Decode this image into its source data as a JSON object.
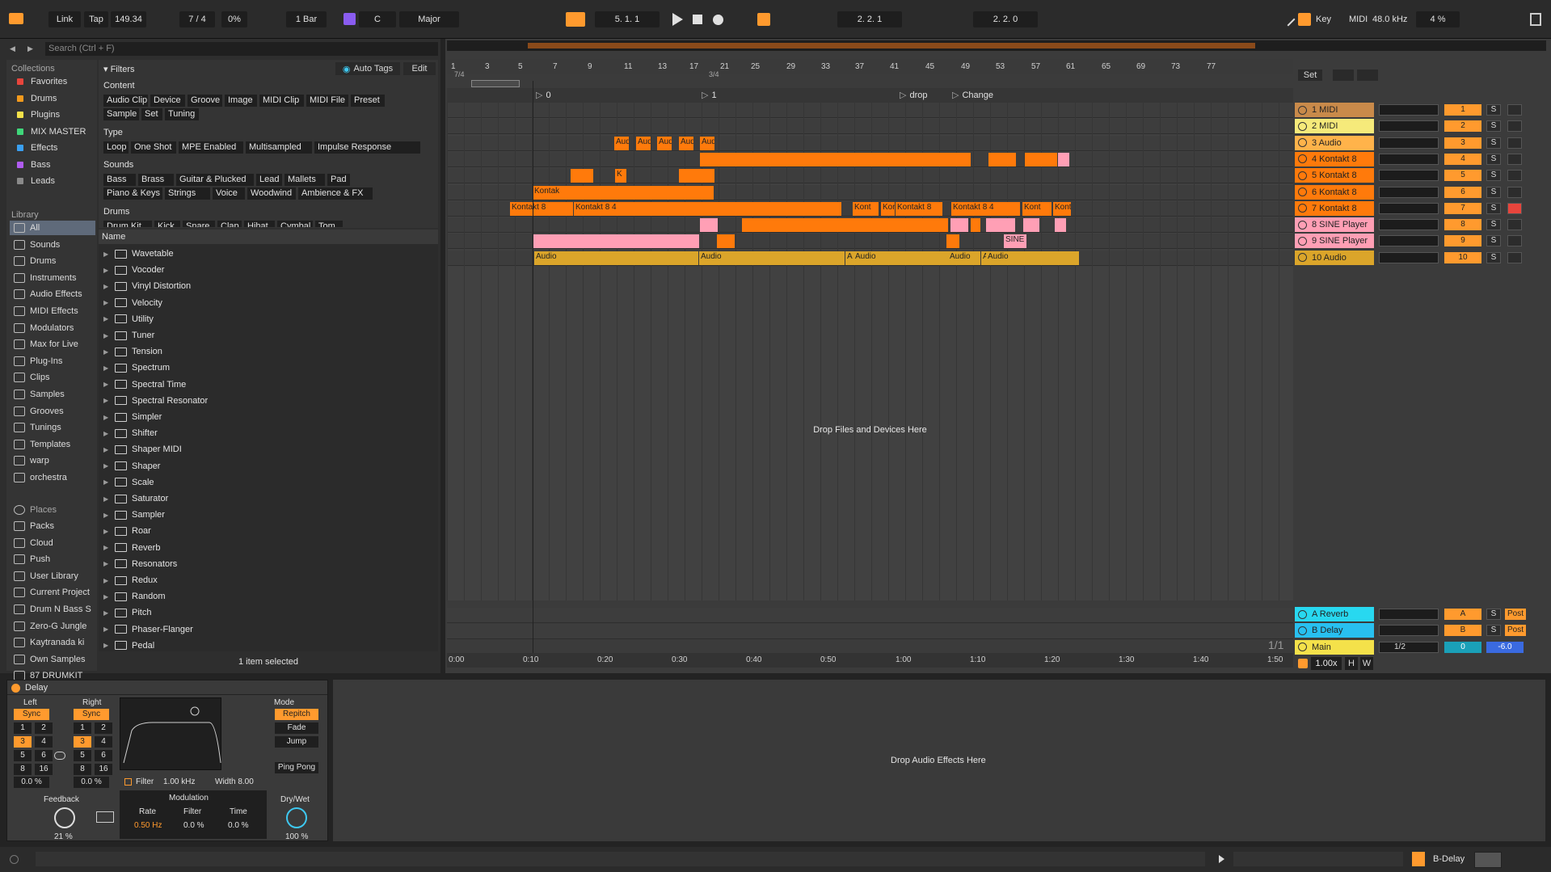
{
  "topbar": {
    "link": "Link",
    "tap": "Tap",
    "tempo": "149.34",
    "signature": "7 / 4",
    "swing": "0%",
    "quantize": "1 Bar",
    "key_root": "C",
    "scale": "Major",
    "position": "5.  1.  1",
    "loop_start": "2.  2.  1",
    "loop_length": "2.  2.  0",
    "key_btn": "Key",
    "midi_btn": "MIDI",
    "sample_rate": "48.0 kHz",
    "cpu": "4 %"
  },
  "browser": {
    "search_placeholder": "Search (Ctrl + F)",
    "collections_title": "Collections",
    "collections": [
      {
        "label": "Favorites",
        "color": "#e8453c"
      },
      {
        "label": "Drums",
        "color": "#f39a1d"
      },
      {
        "label": "Plugins",
        "color": "#f4e14a"
      },
      {
        "label": "MIX MASTER",
        "color": "#3fd67a"
      },
      {
        "label": "Effects",
        "color": "#3aa0f2"
      },
      {
        "label": "Bass",
        "color": "#b05cf0"
      },
      {
        "label": "Leads",
        "color": "#8a8a8a"
      }
    ],
    "library_title": "Library",
    "library": [
      "All",
      "Sounds",
      "Drums",
      "Instruments",
      "Audio Effects",
      "MIDI Effects",
      "Modulators",
      "Max for Live",
      "Plug-Ins",
      "Clips",
      "Samples",
      "Grooves",
      "Tunings",
      "Templates",
      "warp",
      "orchestra"
    ],
    "places_title": "Places",
    "places": [
      "Packs",
      "Cloud",
      "Push",
      "User Library",
      "Current Project",
      "Drum N Bass S",
      "Zero-G Jungle",
      "Kaytranada ki",
      "Own Samples",
      "87 DRUMKIT"
    ],
    "filters": {
      "title": "Filters",
      "auto_tags": "Auto Tags",
      "edit": "Edit",
      "content_label": "Content",
      "content": [
        "Audio Clip",
        "Device",
        "Groove",
        "Image",
        "MIDI Clip",
        "MIDI File",
        "Preset",
        "Sample",
        "Set",
        "Tuning"
      ],
      "type_label": "Type",
      "type": [
        "Loop",
        "One Shot",
        "MPE Enabled",
        "Multisampled",
        "Impulse Response"
      ],
      "sounds_label": "Sounds",
      "sounds": [
        "Bass",
        "Brass",
        "Guitar & Plucked",
        "Lead",
        "Mallets",
        "Pad",
        "Piano & Keys",
        "Strings",
        "Voice",
        "Woodwind",
        "Ambience & FX"
      ],
      "drums_label": "Drums",
      "drums": [
        "Drum Kit",
        "Kick",
        "Snare",
        "Clap",
        "Hihat",
        "Cymbal",
        "Tom"
      ]
    },
    "list_header": "Name",
    "items": [
      "Wavetable",
      "Vocoder",
      "Vinyl Distortion",
      "Velocity",
      "Utility",
      "Tuner",
      "Tension",
      "Spectrum",
      "Spectral Time",
      "Spectral Resonator",
      "Simpler",
      "Shifter",
      "Shaper MIDI",
      "Shaper",
      "Scale",
      "Saturator",
      "Sampler",
      "Roar",
      "Reverb",
      "Resonators",
      "Redux",
      "Random",
      "Pitch",
      "Phaser-Flanger",
      "Pedal"
    ],
    "status": "1 item selected"
  },
  "arrangement": {
    "bar_labels": [
      "1",
      "3",
      "5",
      "7",
      "9",
      "11",
      "13",
      "17",
      "21",
      "25",
      "29",
      "33",
      "37",
      "41",
      "45",
      "49",
      "53",
      "57",
      "61",
      "65",
      "69",
      "73",
      "77"
    ],
    "signature_markers": [
      "7/4",
      "3/4"
    ],
    "locators": [
      "0",
      "1",
      "drop",
      "Change"
    ],
    "drop_hint": "Drop Files and Devices Here",
    "time_labels": [
      "0:00",
      "0:10",
      "0:20",
      "0:30",
      "0:40",
      "0:50",
      "1:00",
      "1:10",
      "1:20",
      "1:30",
      "1:40",
      "1:50"
    ],
    "page_indicator": "1/1",
    "set_btn": "Set",
    "clip_labels": {
      "aud": "Aud",
      "kontakt": "Kontakt 8",
      "kontakt84": "Kontakt 8 4",
      "kont": "Kont",
      "k": "K",
      "kontak": "Kontak",
      "sine": "SINE",
      "audio": "Audio",
      "a": "A"
    }
  },
  "tracks": [
    {
      "name": "1 MIDI",
      "num": "1",
      "color": "#c98a4a"
    },
    {
      "name": "2 MIDI",
      "num": "2",
      "color": "#f6ea7a"
    },
    {
      "name": "3 Audio",
      "num": "3",
      "color": "#ffb34a"
    },
    {
      "name": "4 Kontakt 8",
      "num": "4",
      "color": "#ff7a0b"
    },
    {
      "name": "5 Kontakt 8",
      "num": "5",
      "color": "#ff7a0b"
    },
    {
      "name": "6 Kontakt 8",
      "num": "6",
      "color": "#ff7a0b"
    },
    {
      "name": "7 Kontakt 8",
      "num": "7",
      "color": "#ff7a0b"
    },
    {
      "name": "8 SINE Player",
      "num": "8",
      "color": "#ff9fb5"
    },
    {
      "name": "9 SINE Player",
      "num": "9",
      "color": "#ff9fb5"
    },
    {
      "name": "10 Audio",
      "num": "10",
      "color": "#dba52a"
    }
  ],
  "returns": [
    {
      "name": "A Reverb",
      "num": "A",
      "color": "#28d8f0",
      "post": "Post"
    },
    {
      "name": "B Delay",
      "num": "B",
      "color": "#28c0f0",
      "post": "Post"
    },
    {
      "name": "Main",
      "num": "0",
      "color": "#f4e14a",
      "cue": "1/2",
      "vol": "-6.0"
    }
  ],
  "zoom": {
    "value": "1.00x",
    "h": "H",
    "w": "W"
  },
  "device": {
    "title": "Delay",
    "left": "Left",
    "right": "Right",
    "sync": "Sync",
    "mode": "Mode",
    "mode_options": [
      "Repitch",
      "Fade",
      "Jump"
    ],
    "ping_pong": "Ping Pong",
    "left_pct": "0.0 %",
    "right_pct": "0.0 %",
    "filter": "Filter",
    "filter_freq": "1.00 kHz",
    "width": "Width 8.00",
    "feedback": "Feedback",
    "feedback_val": "21 %",
    "modulation": "Modulation",
    "rate": "Rate",
    "rate_val": "0.50 Hz",
    "mod_filter": "Filter",
    "mod_filter_val": "0.0 %",
    "time": "Time",
    "time_val": "0.0 %",
    "drywet": "Dry/Wet",
    "drywet_val": "100 %",
    "steps": [
      "1",
      "2",
      "3",
      "4",
      "5",
      "6",
      "8",
      "16"
    ],
    "drop_hint": "Drop Audio Effects Here"
  },
  "status": {
    "selected_track": "B-Delay"
  }
}
